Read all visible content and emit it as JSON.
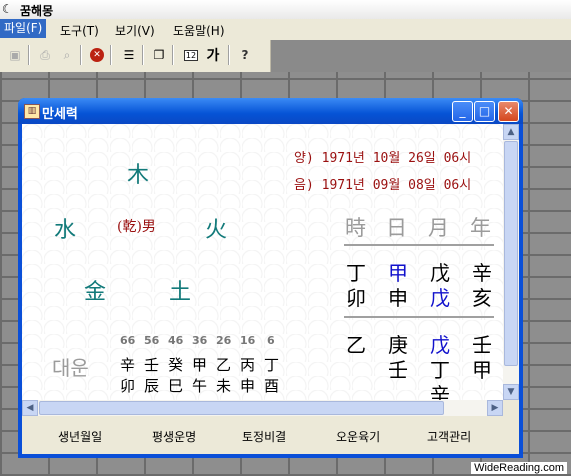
{
  "app": {
    "title": "꿈해몽",
    "icon": "moon-icon"
  },
  "menu": [
    "파일(F)",
    "도구(T)",
    "보기(V)",
    "도움말(H)"
  ],
  "toolbar": {
    "items": [
      "save-icon",
      "print-icon",
      "print-preview-icon",
      "block-icon",
      "list-icon",
      "copy-icon",
      "calendar-icon",
      "font-icon",
      "help-icon"
    ],
    "calendar_label": "12",
    "font_label": "가",
    "help_label": "?"
  },
  "window": {
    "title": "만세력"
  },
  "five_elements": {
    "wood": "木",
    "water": "水",
    "fire": "火",
    "metal": "金",
    "earth": "土",
    "gender": "(乾)男"
  },
  "dates": {
    "solar": "양) 1971년 10월 26일 06시",
    "lunar": "음) 1971년 09월 08일 06시"
  },
  "pillars": {
    "headers": [
      "時",
      "日",
      "月",
      "年"
    ],
    "stems": [
      "丁",
      "甲",
      "戊",
      "辛"
    ],
    "branches": [
      "卯",
      "申",
      "戊",
      "亥"
    ],
    "hidden": [
      [
        "乙",
        ""
      ],
      [
        "庚",
        "壬"
      ],
      [
        "戊",
        "丁",
        "辛"
      ],
      [
        "壬",
        "甲"
      ]
    ]
  },
  "daeun": {
    "label": "대운",
    "ages": [
      "66",
      "56",
      "46",
      "36",
      "26",
      "16",
      "6"
    ],
    "stems": [
      "辛",
      "壬",
      "癸",
      "甲",
      "乙",
      "丙",
      "丁"
    ],
    "branches": [
      "卯",
      "辰",
      "巳",
      "午",
      "未",
      "申",
      "酉"
    ]
  },
  "buttons": [
    "생년월일",
    "평생운명",
    "토정비결",
    "오운육기",
    "고객관리"
  ],
  "watermark": "WideReading.com",
  "colors": {
    "accent": "#1111cc",
    "date": "#9a1010",
    "element": "#127a7a"
  }
}
